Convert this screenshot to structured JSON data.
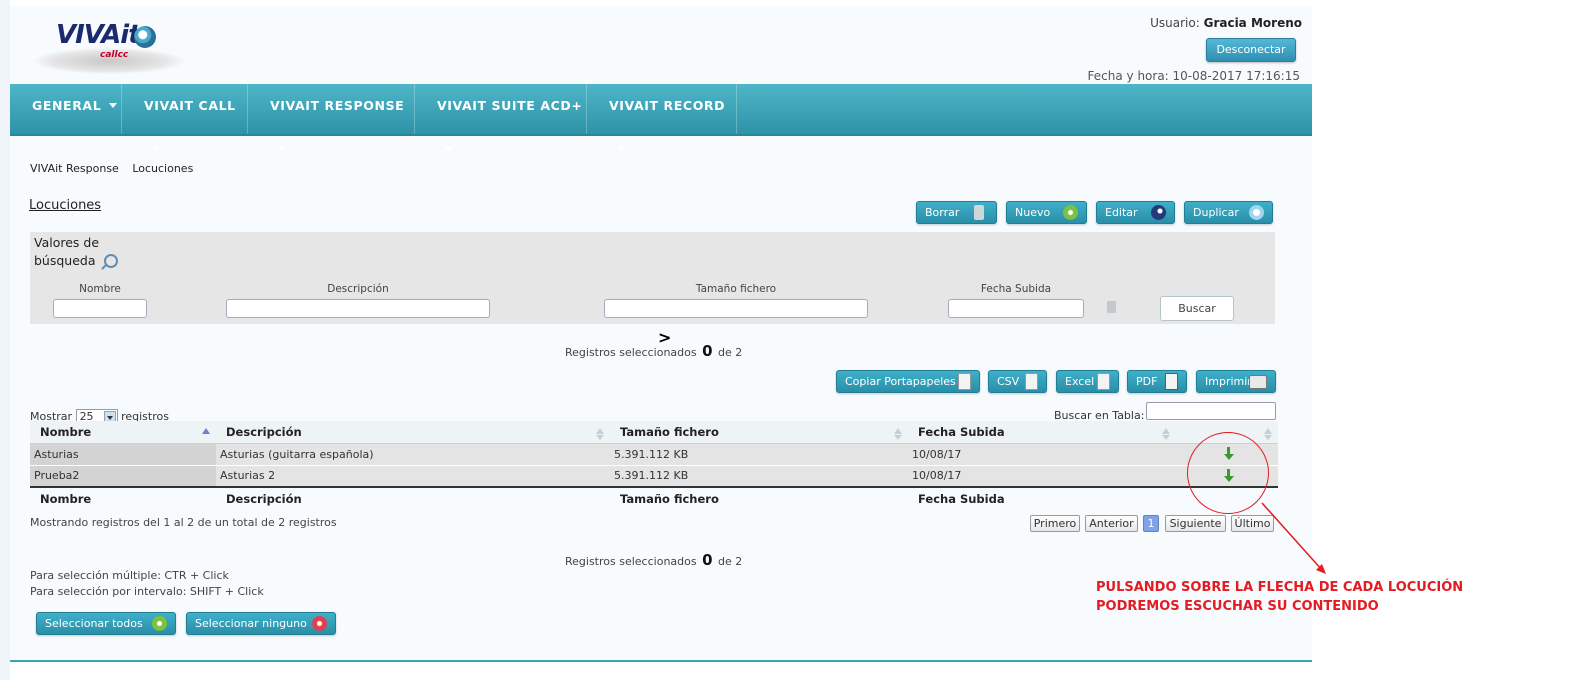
{
  "header": {
    "logo_text": "VIVAit",
    "logo_sub": "callcc",
    "user_label": "Usuario:",
    "user_name": "Gracia Moreno",
    "logout_label": "Desconectar",
    "datetime": "Fecha y hora: 10-08-2017 17:16:15"
  },
  "nav": [
    {
      "label": "GENERAL"
    },
    {
      "label": "VIVAIT CALL"
    },
    {
      "label": "VIVAIT RESPONSE"
    },
    {
      "label": "VIVAIT SUITE ACD+"
    },
    {
      "label": "VIVAIT RECORD"
    }
  ],
  "breadcrumb": [
    "VIVAit Response",
    "Locuciones"
  ],
  "page_title": "Locuciones",
  "toolbar": {
    "delete_label": "Borrar",
    "new_label": "Nuevo",
    "edit_label": "Editar",
    "duplicate_label": "Duplicar"
  },
  "search": {
    "title_line1": "Valores de",
    "title_line2": "búsqueda",
    "fields": [
      "Nombre",
      "Descripción",
      "Tamaño fichero",
      "Fecha Subida"
    ],
    "button_label": "Buscar"
  },
  "selection": {
    "prefix": "Registros seleccionados",
    "count": "0",
    "suffix": "de 2"
  },
  "export": {
    "copy_label": "Copiar Portapapeles",
    "csv_label": "CSV",
    "excel_label": "Excel",
    "pdf_label": "PDF",
    "print_label": "Imprimir"
  },
  "table_controls": {
    "show_prefix": "Mostrar",
    "show_value": "25",
    "show_suffix": "registros",
    "search_label": "Buscar en Tabla:"
  },
  "table": {
    "columns": [
      "Nombre",
      "Descripción",
      "Tamaño fichero",
      "Fecha Subida"
    ],
    "rows": [
      {
        "name": "Asturias",
        "description": "Asturias (guitarra española)",
        "size": "5.391.112 KB",
        "date": "10/08/17"
      },
      {
        "name": "Prueba2",
        "description": "Asturias 2",
        "size": "5.391.112 KB",
        "date": "10/08/17"
      }
    ],
    "info": "Mostrando registros del 1 al 2 de un total de 2 registros"
  },
  "pagination": {
    "first": "Primero",
    "prev": "Anterior",
    "current": "1",
    "next": "Siguiente",
    "last": "Último"
  },
  "hints": {
    "multi": "Para selección múltiple: CTR + Click",
    "range": "Para selección por intervalo: SHIFT + Click"
  },
  "bottom_buttons": {
    "select_all": "Seleccionar todos",
    "select_none": "Seleccionar ninguno"
  },
  "annotation": {
    "line1": "PULSANDO SOBRE LA FLECHA DE CADA LOCUCIÓN",
    "line2": "PODREMOS ESCUCHAR SU CONTENIDO",
    "color": "#e31b23"
  },
  "colors": {
    "nav_bar": "#3aa3b6",
    "button": "#2f98b0"
  }
}
